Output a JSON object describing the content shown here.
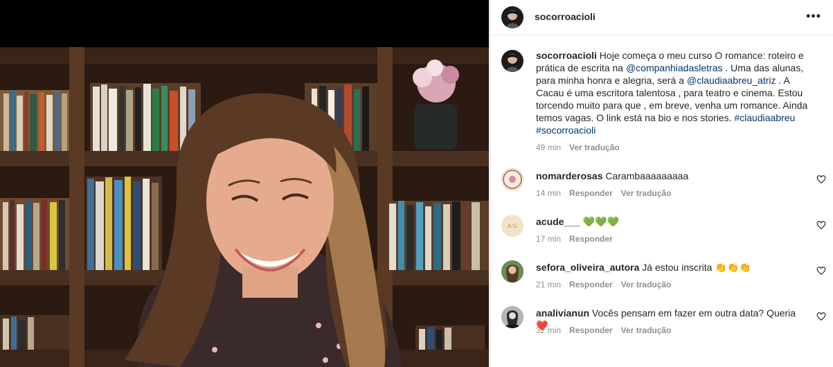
{
  "post": {
    "photo_alt": "foto",
    "author": "socorroacioli",
    "more_icon": "more-icon",
    "caption": {
      "username": "socorroacioli",
      "text_1": " Hoje começa o meu curso O romance: roteiro e prática de escrita na ",
      "mention_1": "@companhiadasletras",
      "text_2": " . Uma das alunas, para minha honra e alegria, será a ",
      "mention_2": "@claudiaabreu_atriz",
      "text_3": " . A Cacau é uma escritora talentosa , para teatro e cinema. Estou torcendo muito para que , em breve, venha um romance. Ainda temos vagas. O link está na bio e nos stories. ",
      "tag_1": "#claudiaabreu",
      "tag_2": "#socorroacioli",
      "time": "49 min",
      "translate": "Ver tradução"
    }
  },
  "comments": [
    {
      "username": "nomarderosas",
      "text": "Carambaaaaaaaaa",
      "time": "14 min",
      "reply": "Responder",
      "translate": "Ver tradução"
    },
    {
      "username": "acude___",
      "text": "💚💚💚",
      "time": "17 min",
      "reply": "Responder",
      "translate": ""
    },
    {
      "username": "sefora_oliveira_autora",
      "text": "Já estou inscrita 👏👏👏",
      "time": "21 min",
      "reply": "Responder",
      "translate": "Ver tradução"
    },
    {
      "username": "analivianun",
      "text": "Vocês pensam em fazer em outra data? Queria ❤️",
      "time": "32 min",
      "reply": "Responder",
      "translate": "Ver tradução"
    }
  ],
  "colors": {
    "link": "#00376b",
    "muted": "#8e8e8e",
    "border": "#dbdbdb"
  }
}
